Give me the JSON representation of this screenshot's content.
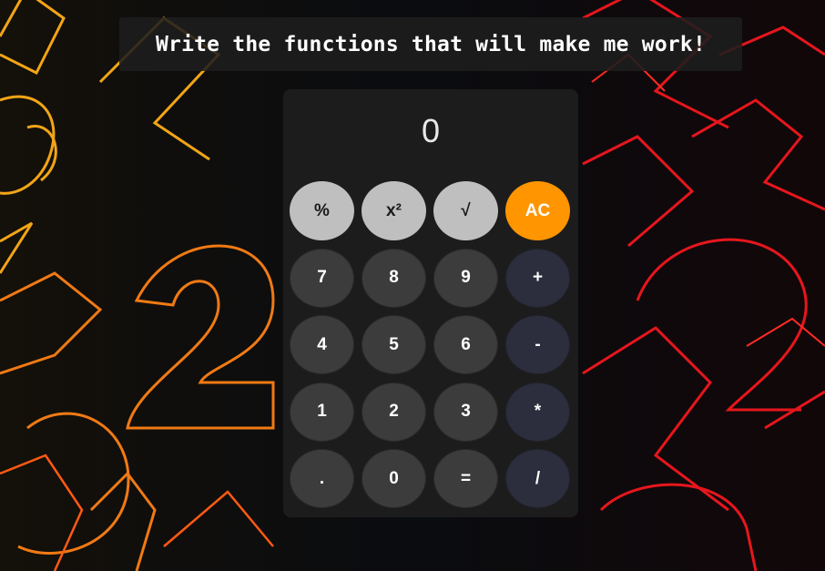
{
  "banner": {
    "text": "Write the functions that will make me work!"
  },
  "calculator": {
    "display_value": "0",
    "rows": [
      [
        {
          "label": "%",
          "name": "percent-button",
          "kind": "func"
        },
        {
          "label": "x²",
          "name": "square-button",
          "kind": "func"
        },
        {
          "label": "√",
          "name": "square-root-button",
          "kind": "func"
        },
        {
          "label": "AC",
          "name": "all-clear-button",
          "kind": "ac"
        }
      ],
      [
        {
          "label": "7",
          "name": "digit-7-button",
          "kind": "num"
        },
        {
          "label": "8",
          "name": "digit-8-button",
          "kind": "num"
        },
        {
          "label": "9",
          "name": "digit-9-button",
          "kind": "num"
        },
        {
          "label": "+",
          "name": "add-button",
          "kind": "op"
        }
      ],
      [
        {
          "label": "4",
          "name": "digit-4-button",
          "kind": "num"
        },
        {
          "label": "5",
          "name": "digit-5-button",
          "kind": "num"
        },
        {
          "label": "6",
          "name": "digit-6-button",
          "kind": "num"
        },
        {
          "label": "-",
          "name": "subtract-button",
          "kind": "op"
        }
      ],
      [
        {
          "label": "1",
          "name": "digit-1-button",
          "kind": "num"
        },
        {
          "label": "2",
          "name": "digit-2-button",
          "kind": "num"
        },
        {
          "label": "3",
          "name": "digit-3-button",
          "kind": "num"
        },
        {
          "label": "*",
          "name": "multiply-button",
          "kind": "op"
        }
      ],
      [
        {
          "label": ".",
          "name": "decimal-button",
          "kind": "num"
        },
        {
          "label": "0",
          "name": "digit-0-button",
          "kind": "num"
        },
        {
          "label": "=",
          "name": "equals-button",
          "kind": "num"
        },
        {
          "label": "/",
          "name": "divide-button",
          "kind": "op"
        }
      ]
    ]
  },
  "colors": {
    "accent_orange": "#ff9500",
    "function_key": "#bfbfbf",
    "number_key": "#3c3c3c",
    "operator_key": "#2c2e3d",
    "panel": "#1c1c1c"
  }
}
